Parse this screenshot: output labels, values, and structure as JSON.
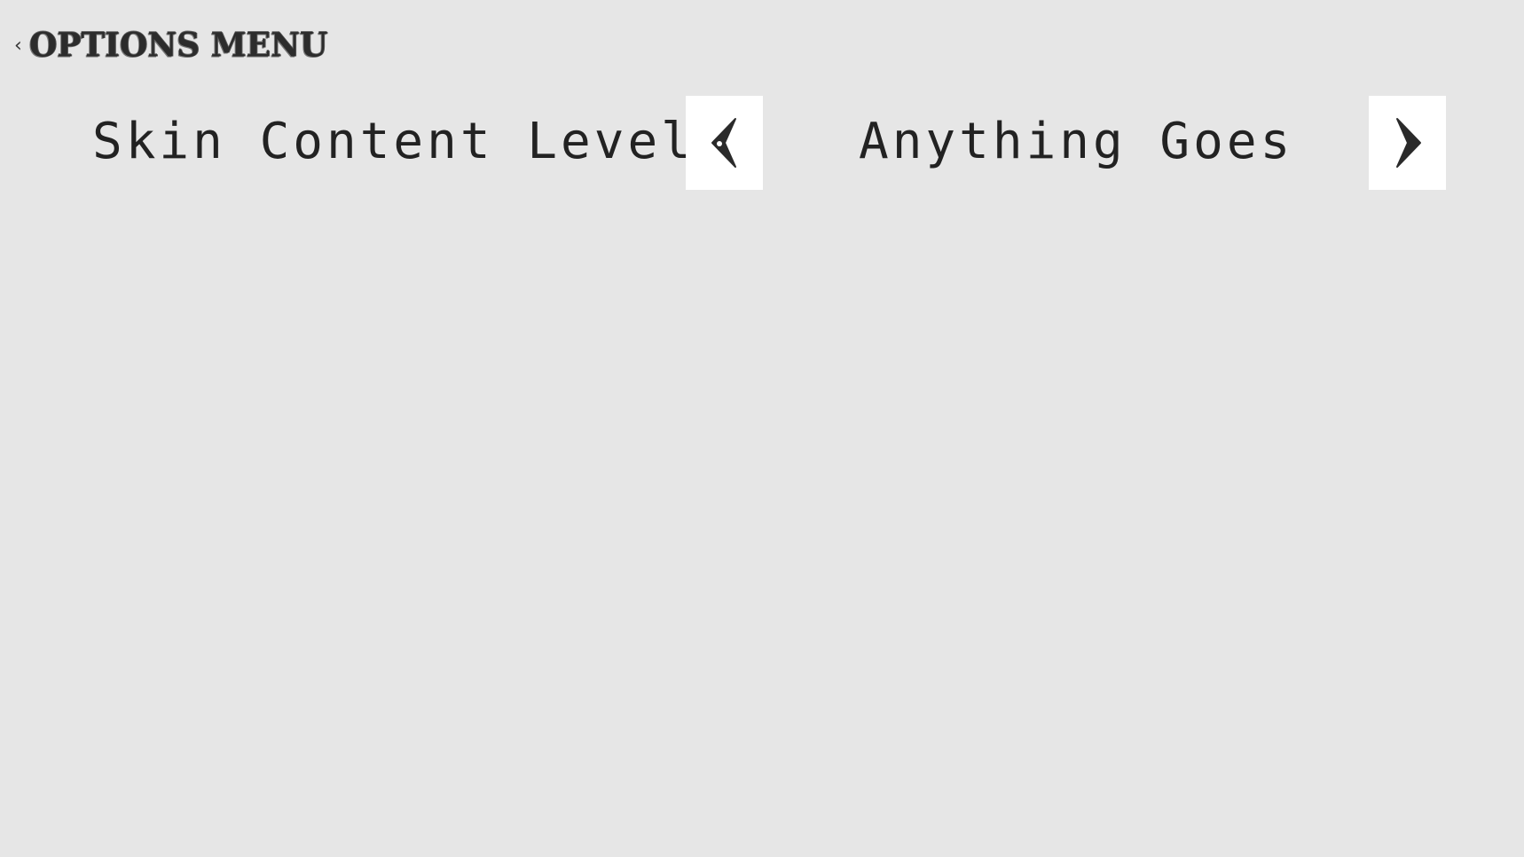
{
  "header": {
    "back_chevron": "‹",
    "title": "Options Menu"
  },
  "option": {
    "label": "Skin Content Level",
    "value": "Anything Goes"
  },
  "icons": {
    "prev": "chevron-left-icon",
    "next": "chevron-right-icon",
    "back": "chevron-left-icon"
  },
  "colors": {
    "background": "#e6e6e6",
    "button": "#ffffff",
    "text": "#222222"
  }
}
